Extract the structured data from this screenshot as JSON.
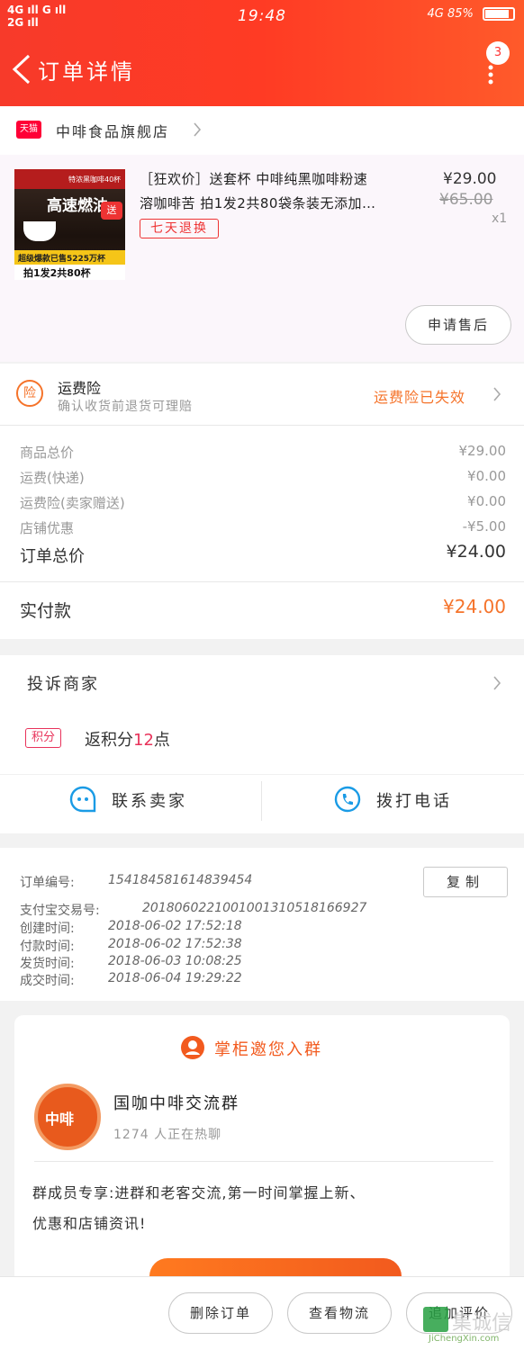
{
  "status_bar": {
    "left_top": "4G ıll G ıll",
    "left_bottom": "2G ıll",
    "time": "19:48",
    "right": "4G 85%"
  },
  "header": {
    "title": "订单详情",
    "badge_count": "3"
  },
  "store": {
    "tag": "天猫",
    "name": "中啡食品旗舰店"
  },
  "product": {
    "title_line1": "［狂欢价］送套杯 中啡纯黑咖啡粉速",
    "title_line2": "溶咖啡苦 拍1发2共80袋条装无添加…",
    "price": "¥29.00",
    "original_price": "¥65.00",
    "quantity": "x1",
    "tag": "七天退换",
    "image_text": {
      "top": "特浓黑咖啡40杯",
      "main": "高速燃油",
      "sub": "超级爆款已售5225万杯",
      "bottom": "拍1发2共80杯",
      "send": "送"
    },
    "after_sale_button": "申请售后"
  },
  "insurance": {
    "icon_char": "险",
    "title": "运费险",
    "desc": "确认收货前退货可理赔",
    "status": "运费险已失效",
    "status_color": "#f5732a"
  },
  "fees": [
    {
      "label": "商品总价",
      "value": "¥29.00"
    },
    {
      "label": "运费(快递)",
      "value": "¥0.00"
    },
    {
      "label": "运费险(卖家赠送)",
      "value": "¥0.00"
    },
    {
      "label": "店铺优惠",
      "value": "-¥5.00"
    }
  ],
  "order_total": {
    "label": "订单总价",
    "value": "¥24.00"
  },
  "paid": {
    "label": "实付款",
    "value": "¥24.00"
  },
  "complaint": {
    "label": "投诉商家"
  },
  "points": {
    "tag": "积分",
    "prefix": "返积分",
    "value": "12",
    "suffix": "点"
  },
  "contact": {
    "seller": "联系卖家",
    "call": "拨打电话"
  },
  "order_info": {
    "copy_button": "复制",
    "rows": [
      {
        "label": "订单编号:",
        "value": "154184581614839454"
      },
      {
        "label": "支付宝交易号:",
        "value": "2018060221001001310518166927"
      },
      {
        "label": "创建时间:",
        "value": "2018-06-02 17:52:18"
      },
      {
        "label": "付款时间:",
        "value": "2018-06-02 17:52:38"
      },
      {
        "label": "发货时间:",
        "value": "2018-06-03 10:08:25"
      },
      {
        "label": "成交时间:",
        "value": "2018-06-04 19:29:22"
      }
    ]
  },
  "group": {
    "header": "掌柜邀您入群",
    "name": "国咖中啡交流群",
    "members": "1274 人正在热聊",
    "logo_text": "中啡",
    "benefit_line1": "群成员专享:进群和老客交流,第一时间掌握上新、",
    "benefit_line2": "优惠和店铺资讯!"
  },
  "bottom_bar": {
    "delete": "删除订单",
    "logistics": "查看物流",
    "review": "追加评价"
  },
  "watermark": {
    "main": "集诚信",
    "sub": "JiChengXin.com"
  },
  "colors": {
    "brand_red": "#ff3b24",
    "accent_orange": "#f5732a",
    "tag_red": "#e33",
    "points_pink": "#e8325a",
    "group_orange": "#f25a1e"
  }
}
